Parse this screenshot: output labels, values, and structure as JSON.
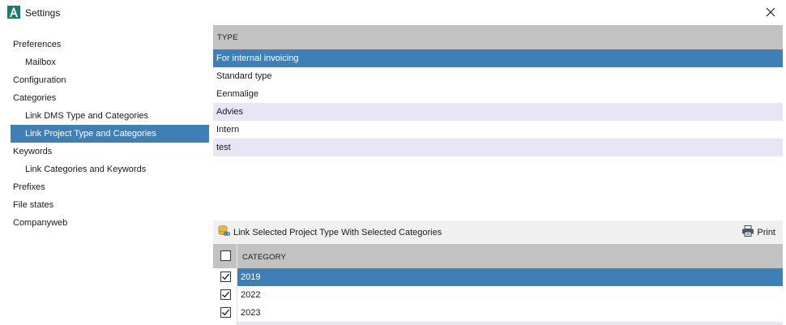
{
  "window": {
    "title": "Settings"
  },
  "sidebar": {
    "items": [
      {
        "label": "Preferences",
        "level": 0,
        "active": false
      },
      {
        "label": "Mailbox",
        "level": 1,
        "active": false
      },
      {
        "label": "Configuration",
        "level": 0,
        "active": false
      },
      {
        "label": "Categories",
        "level": 0,
        "active": false
      },
      {
        "label": "Link DMS Type and Categories",
        "level": 1,
        "active": false
      },
      {
        "label": "Link Project Type and Categories",
        "level": 1,
        "active": true
      },
      {
        "label": "Keywords",
        "level": 0,
        "active": false
      },
      {
        "label": "Link Categories and Keywords",
        "level": 1,
        "active": false
      },
      {
        "label": "Prefixes",
        "level": 0,
        "active": false
      },
      {
        "label": "File states",
        "level": 0,
        "active": false
      },
      {
        "label": "Companyweb",
        "level": 0,
        "active": false
      }
    ]
  },
  "type_grid": {
    "header": "TYPE",
    "rows": [
      {
        "label": "For internal invoicing",
        "selected": true
      },
      {
        "label": "Standard type",
        "selected": false
      },
      {
        "label": "Eenmalige",
        "selected": false
      },
      {
        "label": "Advies",
        "selected": false
      },
      {
        "label": "Intern",
        "selected": false
      },
      {
        "label": "test",
        "selected": false
      }
    ]
  },
  "toolbar": {
    "link_label": "Link Selected Project Type With Selected Categories",
    "print_label": "Print"
  },
  "category_grid": {
    "header": "CATEGORY",
    "header_checked": false,
    "rows": [
      {
        "label": "2019",
        "checked": true,
        "selected": true
      },
      {
        "label": "2022",
        "checked": true,
        "selected": false
      },
      {
        "label": "2023",
        "checked": true,
        "selected": false
      }
    ]
  },
  "colors": {
    "selection": "#3f7fb8",
    "alt_row": "#e6e6f7",
    "header": "#c2c2c2",
    "toolbar": "#f0f0f0"
  }
}
